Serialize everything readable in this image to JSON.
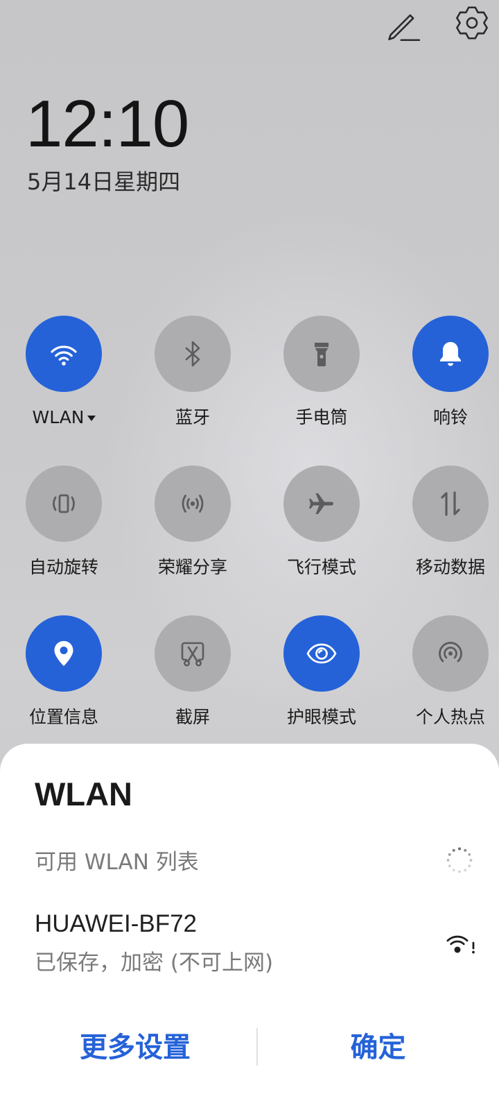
{
  "header": {
    "edit_icon": "pencil-icon",
    "settings_icon": "gear-icon"
  },
  "clock": {
    "time": "12:10",
    "date": "5月14日星期四"
  },
  "tiles": [
    {
      "label": "WLAN",
      "icon": "wifi-icon",
      "active": true,
      "has_dropdown": true
    },
    {
      "label": "蓝牙",
      "icon": "bluetooth-icon",
      "active": false
    },
    {
      "label": "手电筒",
      "icon": "flashlight-icon",
      "active": false
    },
    {
      "label": "响铃",
      "icon": "bell-icon",
      "active": true
    },
    {
      "label": "自动旋转",
      "icon": "auto-rotate-icon",
      "active": false
    },
    {
      "label": "荣耀分享",
      "icon": "share-waves-icon",
      "active": false
    },
    {
      "label": "飞行模式",
      "icon": "airplane-icon",
      "active": false
    },
    {
      "label": "移动数据",
      "icon": "mobile-data-icon",
      "active": false
    },
    {
      "label": "位置信息",
      "icon": "location-icon",
      "active": true
    },
    {
      "label": "截屏",
      "icon": "screenshot-icon",
      "active": false
    },
    {
      "label": "护眼模式",
      "icon": "eye-icon",
      "active": true
    },
    {
      "label": "个人热点",
      "icon": "hotspot-icon",
      "active": false
    }
  ],
  "wlan_dialog": {
    "title": "WLAN",
    "list_header": "可用 WLAN 列表",
    "scanning_icon": "loading-spinner-icon",
    "networks": [
      {
        "ssid": "HUAWEI-BF72",
        "status": "已保存，加密 (不可上网)",
        "icon": "wifi-no-internet-icon"
      }
    ],
    "more_settings": "更多设置",
    "confirm": "确定"
  },
  "colors": {
    "accent": "#2562d8",
    "tile_off": "#adadaf",
    "icon_off": "#5c5c5e",
    "sheet": "#ffffff"
  }
}
